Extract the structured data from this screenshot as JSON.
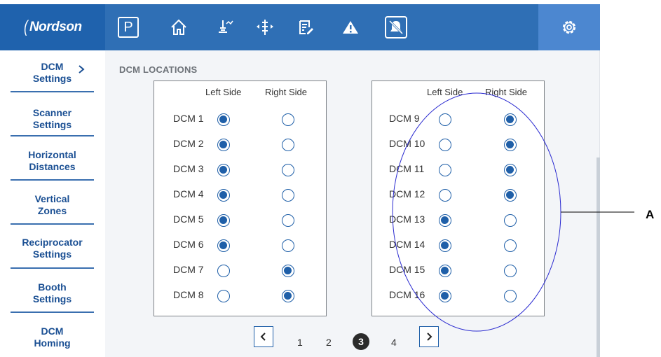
{
  "logo": {
    "text": "Nordson"
  },
  "toolbar": {
    "icons": [
      "parking-icon",
      "home-icon",
      "spray-gun-icon",
      "traverse-icon",
      "edit-list-icon",
      "warning-icon",
      "alarm-muted-icon",
      "gear-icon"
    ],
    "parking_label": "P"
  },
  "sidebar": {
    "items": [
      {
        "line1": "DCM",
        "line2": "Settings"
      },
      {
        "line1": "Scanner",
        "line2": "Settings"
      },
      {
        "line1": "Horizontal",
        "line2": "Distances"
      },
      {
        "line1": "Vertical",
        "line2": "Zones"
      },
      {
        "line1": "Reciprocator",
        "line2": "Settings"
      },
      {
        "line1": "Booth",
        "line2": "Settings"
      },
      {
        "line1": "DCM",
        "line2": "Homing"
      }
    ]
  },
  "main": {
    "section_title": "DCM LOCATIONS",
    "col_left": "Left Side",
    "col_right": "Right Side",
    "panels": [
      {
        "rows": [
          {
            "label": "DCM 1",
            "side": "left"
          },
          {
            "label": "DCM 2",
            "side": "left"
          },
          {
            "label": "DCM 3",
            "side": "left"
          },
          {
            "label": "DCM 4",
            "side": "left"
          },
          {
            "label": "DCM 5",
            "side": "left"
          },
          {
            "label": "DCM 6",
            "side": "left"
          },
          {
            "label": "DCM 7",
            "side": "right"
          },
          {
            "label": "DCM 8",
            "side": "right"
          }
        ]
      },
      {
        "rows": [
          {
            "label": "DCM 9",
            "side": "right"
          },
          {
            "label": "DCM 10",
            "side": "right"
          },
          {
            "label": "DCM 11",
            "side": "right"
          },
          {
            "label": "DCM 12",
            "side": "right"
          },
          {
            "label": "DCM 13",
            "side": "left"
          },
          {
            "label": "DCM 14",
            "side": "left"
          },
          {
            "label": "DCM 15",
            "side": "left"
          },
          {
            "label": "DCM 16",
            "side": "left"
          }
        ]
      }
    ]
  },
  "pagination": {
    "pages": [
      "1",
      "2",
      "3",
      "4"
    ],
    "current": "3"
  },
  "annotation": {
    "label": "A"
  },
  "colors": {
    "topbar": "#2f6fb5",
    "gear_active": "#4c87d0",
    "accent": "#1f5fa8",
    "annotation_line": "#2a2ad0"
  }
}
